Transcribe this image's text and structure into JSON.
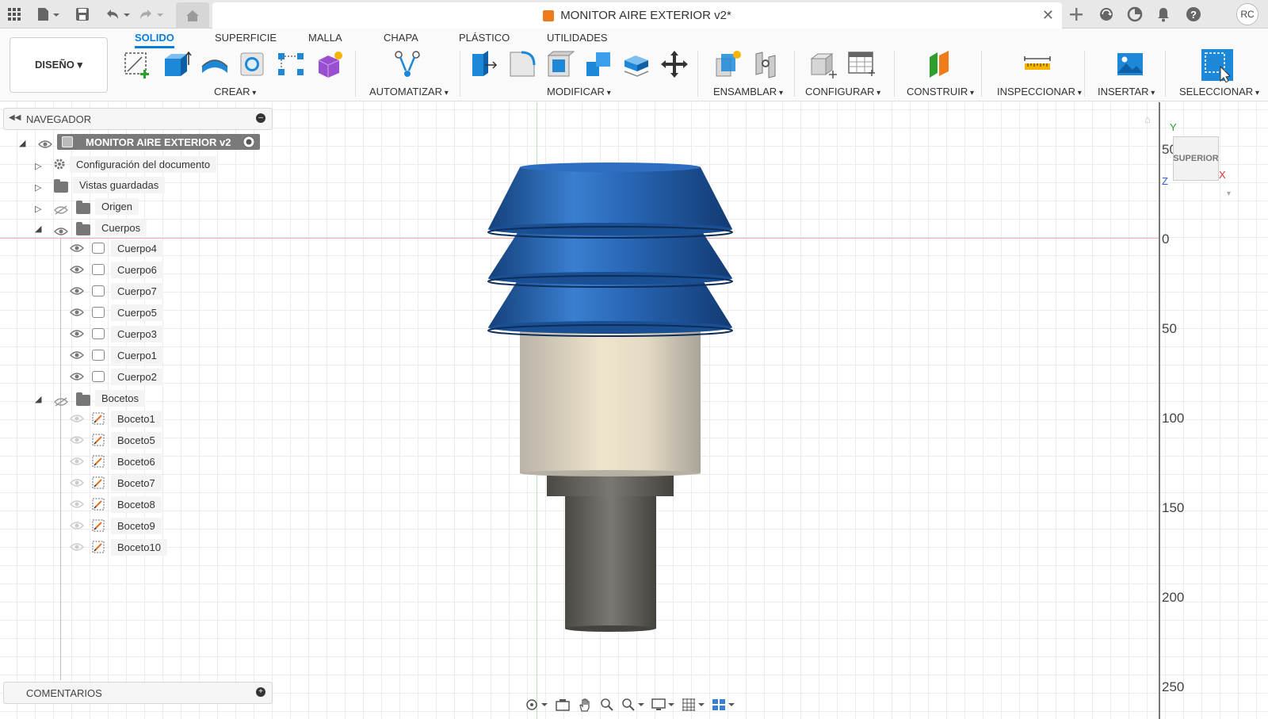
{
  "window": {
    "title": "MONITOR AIRE EXTERIOR v2*",
    "avatar_initials": "RC"
  },
  "ribbon": {
    "workspace_button": "DISEÑO ▾",
    "tabs": [
      "SOLIDO",
      "SUPERFICIE",
      "MALLA",
      "CHAPA",
      "PLÁSTICO",
      "UTILIDADES"
    ],
    "active_tab": "SOLIDO",
    "groups": [
      "CREAR",
      "AUTOMATIZAR",
      "MODIFICAR",
      "ENSAMBLAR",
      "CONFIGURAR",
      "CONSTRUIR",
      "INSPECCIONAR",
      "INSERTAR",
      "SELECCIONAR"
    ]
  },
  "navigator": {
    "title": "NAVEGADOR",
    "root": "MONITOR AIRE EXTERIOR v2",
    "items": {
      "doc_settings": "Configuración del documento",
      "saved_views": "Vistas guardadas",
      "origin": "Origen",
      "bodies": "Cuerpos",
      "sketches": "Bocetos"
    },
    "bodies": [
      "Cuerpo4",
      "Cuerpo6",
      "Cuerpo7",
      "Cuerpo5",
      "Cuerpo3",
      "Cuerpo1",
      "Cuerpo2"
    ],
    "sketches": [
      "Boceto1",
      "Boceto5",
      "Boceto6",
      "Boceto7",
      "Boceto8",
      "Boceto9",
      "Boceto10"
    ]
  },
  "comments": {
    "title": "COMENTARIOS"
  },
  "viewcube": {
    "face": "SUPERIOR",
    "axis_y": "Y",
    "axis_x": "X",
    "axis_z": "Z"
  },
  "ruler": {
    "labels": [
      "50",
      "0",
      "50",
      "100",
      "150",
      "200",
      "250"
    ]
  },
  "colors": {
    "accent": "#0a7dd8",
    "louver_blue": "#1f5fa8",
    "tube_beige": "#e7dcc6",
    "base_gray": "#6e6c66"
  }
}
